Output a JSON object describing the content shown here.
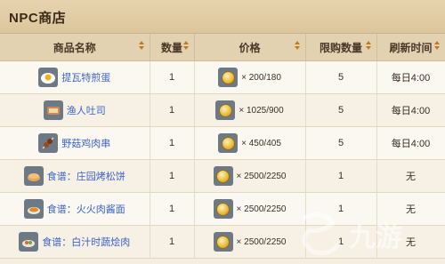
{
  "title": "NPC商店",
  "columns": [
    "商品名称",
    "数量",
    "价格",
    "限购数量",
    "刷新时间"
  ],
  "rows": [
    {
      "icon": "fried-egg-icon",
      "name": "提瓦特煎蛋",
      "qty": "1",
      "price": "× 200/180",
      "limit": "5",
      "refresh": "每日4:00"
    },
    {
      "icon": "toast-icon",
      "name": "渔人吐司",
      "qty": "1",
      "price": "× 1025/900",
      "limit": "5",
      "refresh": "每日4:00"
    },
    {
      "icon": "skewer-icon",
      "name": "野菇鸡肉串",
      "qty": "1",
      "price": "× 450/405",
      "limit": "5",
      "refresh": "每日4:00"
    },
    {
      "icon": "recipe-pancake-icon",
      "name": "食谱：庄园烤松饼",
      "qty": "1",
      "price": "× 2500/2250",
      "limit": "1",
      "refresh": "无"
    },
    {
      "icon": "recipe-ham-icon",
      "name": "食谱：火火肉酱面",
      "qty": "1",
      "price": "× 2500/2250",
      "limit": "1",
      "refresh": "无"
    },
    {
      "icon": "recipe-stew-icon",
      "name": "食谱：白汁时蔬烩肉",
      "qty": "1",
      "price": "× 2500/2250",
      "limit": "1",
      "refresh": "无"
    }
  ],
  "watermark": "九游",
  "colors": {
    "accent": "#c07a1e",
    "link": "#3a63c8",
    "header": "#e3d2b1"
  }
}
